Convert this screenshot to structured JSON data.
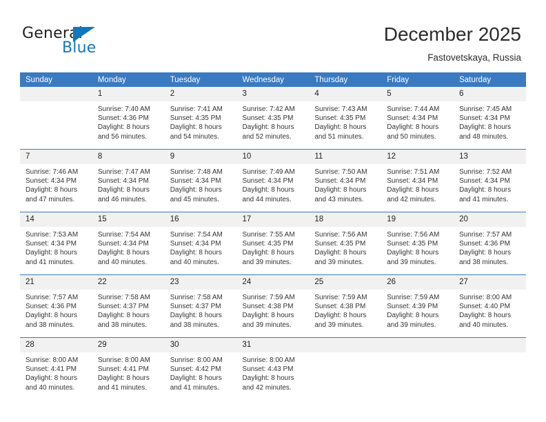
{
  "brand": {
    "name_top": "General",
    "name_bottom": "Blue",
    "accent_color": "#1278be"
  },
  "header": {
    "title": "December 2025",
    "subtitle": "Fastovetskaya, Russia"
  },
  "calendar": {
    "header_bg": "#3a7ac0",
    "daynum_bg": "#f1f1f1",
    "weekday_headers": [
      "Sunday",
      "Monday",
      "Tuesday",
      "Wednesday",
      "Thursday",
      "Friday",
      "Saturday"
    ],
    "weeks": [
      [
        {
          "day": "",
          "sunrise": "",
          "sunset": "",
          "daylight": "",
          "daylight2": ""
        },
        {
          "day": "1",
          "sunrise": "Sunrise: 7:40 AM",
          "sunset": "Sunset: 4:36 PM",
          "daylight": "Daylight: 8 hours",
          "daylight2": "and 56 minutes."
        },
        {
          "day": "2",
          "sunrise": "Sunrise: 7:41 AM",
          "sunset": "Sunset: 4:35 PM",
          "daylight": "Daylight: 8 hours",
          "daylight2": "and 54 minutes."
        },
        {
          "day": "3",
          "sunrise": "Sunrise: 7:42 AM",
          "sunset": "Sunset: 4:35 PM",
          "daylight": "Daylight: 8 hours",
          "daylight2": "and 52 minutes."
        },
        {
          "day": "4",
          "sunrise": "Sunrise: 7:43 AM",
          "sunset": "Sunset: 4:35 PM",
          "daylight": "Daylight: 8 hours",
          "daylight2": "and 51 minutes."
        },
        {
          "day": "5",
          "sunrise": "Sunrise: 7:44 AM",
          "sunset": "Sunset: 4:34 PM",
          "daylight": "Daylight: 8 hours",
          "daylight2": "and 50 minutes."
        },
        {
          "day": "6",
          "sunrise": "Sunrise: 7:45 AM",
          "sunset": "Sunset: 4:34 PM",
          "daylight": "Daylight: 8 hours",
          "daylight2": "and 48 minutes."
        }
      ],
      [
        {
          "day": "7",
          "sunrise": "Sunrise: 7:46 AM",
          "sunset": "Sunset: 4:34 PM",
          "daylight": "Daylight: 8 hours",
          "daylight2": "and 47 minutes."
        },
        {
          "day": "8",
          "sunrise": "Sunrise: 7:47 AM",
          "sunset": "Sunset: 4:34 PM",
          "daylight": "Daylight: 8 hours",
          "daylight2": "and 46 minutes."
        },
        {
          "day": "9",
          "sunrise": "Sunrise: 7:48 AM",
          "sunset": "Sunset: 4:34 PM",
          "daylight": "Daylight: 8 hours",
          "daylight2": "and 45 minutes."
        },
        {
          "day": "10",
          "sunrise": "Sunrise: 7:49 AM",
          "sunset": "Sunset: 4:34 PM",
          "daylight": "Daylight: 8 hours",
          "daylight2": "and 44 minutes."
        },
        {
          "day": "11",
          "sunrise": "Sunrise: 7:50 AM",
          "sunset": "Sunset: 4:34 PM",
          "daylight": "Daylight: 8 hours",
          "daylight2": "and 43 minutes."
        },
        {
          "day": "12",
          "sunrise": "Sunrise: 7:51 AM",
          "sunset": "Sunset: 4:34 PM",
          "daylight": "Daylight: 8 hours",
          "daylight2": "and 42 minutes."
        },
        {
          "day": "13",
          "sunrise": "Sunrise: 7:52 AM",
          "sunset": "Sunset: 4:34 PM",
          "daylight": "Daylight: 8 hours",
          "daylight2": "and 41 minutes."
        }
      ],
      [
        {
          "day": "14",
          "sunrise": "Sunrise: 7:53 AM",
          "sunset": "Sunset: 4:34 PM",
          "daylight": "Daylight: 8 hours",
          "daylight2": "and 41 minutes."
        },
        {
          "day": "15",
          "sunrise": "Sunrise: 7:54 AM",
          "sunset": "Sunset: 4:34 PM",
          "daylight": "Daylight: 8 hours",
          "daylight2": "and 40 minutes."
        },
        {
          "day": "16",
          "sunrise": "Sunrise: 7:54 AM",
          "sunset": "Sunset: 4:34 PM",
          "daylight": "Daylight: 8 hours",
          "daylight2": "and 40 minutes."
        },
        {
          "day": "17",
          "sunrise": "Sunrise: 7:55 AM",
          "sunset": "Sunset: 4:35 PM",
          "daylight": "Daylight: 8 hours",
          "daylight2": "and 39 minutes."
        },
        {
          "day": "18",
          "sunrise": "Sunrise: 7:56 AM",
          "sunset": "Sunset: 4:35 PM",
          "daylight": "Daylight: 8 hours",
          "daylight2": "and 39 minutes."
        },
        {
          "day": "19",
          "sunrise": "Sunrise: 7:56 AM",
          "sunset": "Sunset: 4:35 PM",
          "daylight": "Daylight: 8 hours",
          "daylight2": "and 39 minutes."
        },
        {
          "day": "20",
          "sunrise": "Sunrise: 7:57 AM",
          "sunset": "Sunset: 4:36 PM",
          "daylight": "Daylight: 8 hours",
          "daylight2": "and 38 minutes."
        }
      ],
      [
        {
          "day": "21",
          "sunrise": "Sunrise: 7:57 AM",
          "sunset": "Sunset: 4:36 PM",
          "daylight": "Daylight: 8 hours",
          "daylight2": "and 38 minutes."
        },
        {
          "day": "22",
          "sunrise": "Sunrise: 7:58 AM",
          "sunset": "Sunset: 4:37 PM",
          "daylight": "Daylight: 8 hours",
          "daylight2": "and 38 minutes."
        },
        {
          "day": "23",
          "sunrise": "Sunrise: 7:58 AM",
          "sunset": "Sunset: 4:37 PM",
          "daylight": "Daylight: 8 hours",
          "daylight2": "and 38 minutes."
        },
        {
          "day": "24",
          "sunrise": "Sunrise: 7:59 AM",
          "sunset": "Sunset: 4:38 PM",
          "daylight": "Daylight: 8 hours",
          "daylight2": "and 39 minutes."
        },
        {
          "day": "25",
          "sunrise": "Sunrise: 7:59 AM",
          "sunset": "Sunset: 4:38 PM",
          "daylight": "Daylight: 8 hours",
          "daylight2": "and 39 minutes."
        },
        {
          "day": "26",
          "sunrise": "Sunrise: 7:59 AM",
          "sunset": "Sunset: 4:39 PM",
          "daylight": "Daylight: 8 hours",
          "daylight2": "and 39 minutes."
        },
        {
          "day": "27",
          "sunrise": "Sunrise: 8:00 AM",
          "sunset": "Sunset: 4:40 PM",
          "daylight": "Daylight: 8 hours",
          "daylight2": "and 40 minutes."
        }
      ],
      [
        {
          "day": "28",
          "sunrise": "Sunrise: 8:00 AM",
          "sunset": "Sunset: 4:41 PM",
          "daylight": "Daylight: 8 hours",
          "daylight2": "and 40 minutes."
        },
        {
          "day": "29",
          "sunrise": "Sunrise: 8:00 AM",
          "sunset": "Sunset: 4:41 PM",
          "daylight": "Daylight: 8 hours",
          "daylight2": "and 41 minutes."
        },
        {
          "day": "30",
          "sunrise": "Sunrise: 8:00 AM",
          "sunset": "Sunset: 4:42 PM",
          "daylight": "Daylight: 8 hours",
          "daylight2": "and 41 minutes."
        },
        {
          "day": "31",
          "sunrise": "Sunrise: 8:00 AM",
          "sunset": "Sunset: 4:43 PM",
          "daylight": "Daylight: 8 hours",
          "daylight2": "and 42 minutes."
        },
        {
          "day": "",
          "sunrise": "",
          "sunset": "",
          "daylight": "",
          "daylight2": ""
        },
        {
          "day": "",
          "sunrise": "",
          "sunset": "",
          "daylight": "",
          "daylight2": ""
        },
        {
          "day": "",
          "sunrise": "",
          "sunset": "",
          "daylight": "",
          "daylight2": ""
        }
      ]
    ]
  }
}
